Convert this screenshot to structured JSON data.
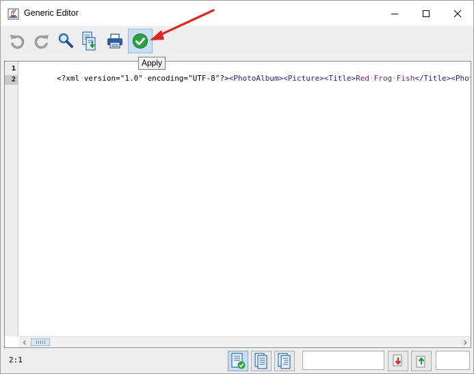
{
  "window": {
    "title": "Generic Editor",
    "app_icon": "java-coffee-icon",
    "controls": {
      "minimize_icon": "minimize-icon",
      "maximize_icon": "maximize-icon",
      "close_icon": "close-icon"
    }
  },
  "toolbar": {
    "buttons": [
      {
        "id": "undo",
        "icon": "undo-icon",
        "enabled": false
      },
      {
        "id": "redo",
        "icon": "redo-icon",
        "enabled": false
      },
      {
        "id": "find",
        "icon": "magnifier-icon",
        "enabled": true
      },
      {
        "id": "save",
        "icon": "save-document-icon",
        "enabled": true
      },
      {
        "id": "print",
        "icon": "printer-icon",
        "enabled": true
      },
      {
        "id": "apply",
        "icon": "green-check-icon",
        "enabled": true,
        "hovered": true
      }
    ],
    "tooltip": "Apply"
  },
  "editor": {
    "line_numbers": [
      "1",
      "2"
    ],
    "current_line": "2",
    "line1_tokens": [
      {
        "text": "<?xml",
        "kind": "plain"
      },
      {
        "text": "·",
        "kind": "sp"
      },
      {
        "text": "version=\"1.0\"",
        "kind": "plain"
      },
      {
        "text": "·",
        "kind": "sp"
      },
      {
        "text": "encoding=\"UTF-8\"?>",
        "kind": "plain"
      },
      {
        "text": "<PhotoAlbum>",
        "kind": "tag"
      },
      {
        "text": "<Picture>",
        "kind": "tag"
      },
      {
        "text": "<Title>",
        "kind": "tag"
      },
      {
        "text": "Red",
        "kind": "text"
      },
      {
        "text": "·",
        "kind": "sp"
      },
      {
        "text": "Frog",
        "kind": "text"
      },
      {
        "text": "·",
        "kind": "sp"
      },
      {
        "text": "Fish",
        "kind": "text"
      },
      {
        "text": "</Title>",
        "kind": "tag"
      },
      {
        "text": "<Photog",
        "kind": "tag"
      }
    ]
  },
  "statusbar": {
    "cursor_position": "2:1",
    "view_buttons": [
      {
        "id": "view-validated",
        "icon": "document-check-icon",
        "selected": true
      },
      {
        "id": "view-document",
        "icon": "document-icon",
        "selected": false
      },
      {
        "id": "view-tree",
        "icon": "document-tree-icon",
        "selected": false
      }
    ],
    "search_value": "",
    "prev_icon": "find-previous-icon",
    "next_icon": "find-next-icon",
    "extra_value": ""
  },
  "colors": {
    "xml_tag": "#1a1aa6",
    "xml_text": "#7b1f7b",
    "apply_green": "#2aa33a",
    "annotation_red": "#e8231f",
    "hover_blue": "#c7dff4"
  }
}
